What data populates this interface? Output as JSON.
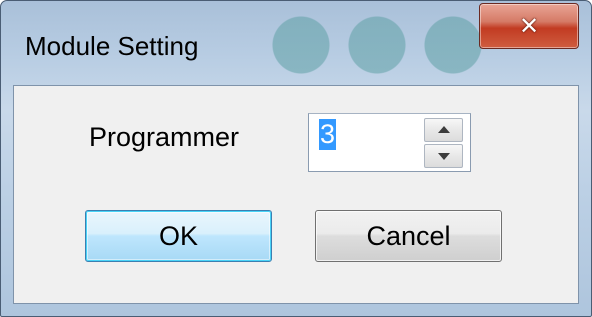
{
  "window": {
    "title": "Module Setting",
    "close_glyph": "✕",
    "close_icon": "close-icon"
  },
  "form": {
    "programmer_label": "Programmer",
    "programmer_value": "3",
    "spin_up_icon": "chevron-up-icon",
    "spin_down_icon": "chevron-down-icon"
  },
  "buttons": {
    "ok_label": "OK",
    "cancel_label": "Cancel"
  },
  "colors": {
    "selection_highlight": "#3399ff",
    "close_button_red": "#c23b22",
    "default_button_blue": "#a7d9f5"
  }
}
